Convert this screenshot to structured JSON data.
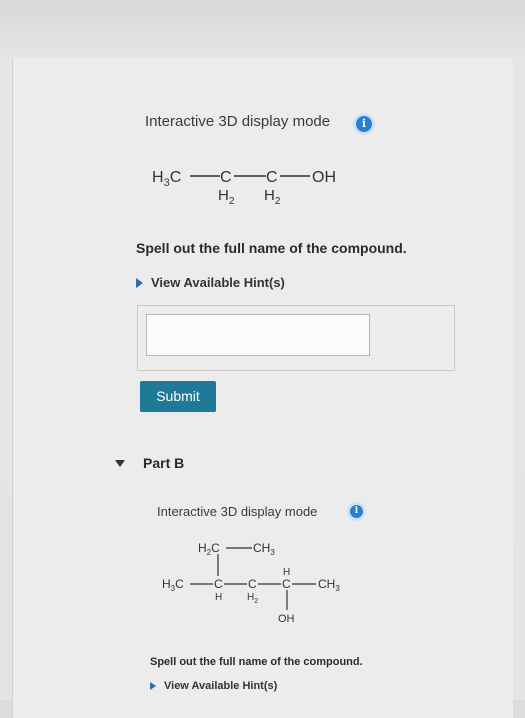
{
  "part_a": {
    "mode_label": "Interactive 3D display mode",
    "info_icon_glyph": "i",
    "molecule": {
      "h3c": "H",
      "h3c_sub": "3",
      "h3c_c": "C",
      "c2": "C",
      "c3": "C",
      "oh": "OH",
      "h2a": "H",
      "h2a_sub": "2",
      "h2b": "H",
      "h2b_sub": "2"
    },
    "question": "Spell out the full name of the compound.",
    "hint_label": "View Available Hint(s)",
    "answer_value": "",
    "submit_label": "Submit"
  },
  "part_b": {
    "title": "Part B",
    "mode_label": "Interactive 3D display mode",
    "info_icon_glyph": "i",
    "molecule": {
      "top_h2c": "H",
      "top_h2c_sub": "2",
      "top_h2c_c": "C",
      "top_ch3": "CH",
      "top_ch3_sub": "3",
      "left_h3c": "H",
      "left_h3c_sub": "3",
      "left_h3c_c": "C",
      "c_a": "C",
      "c_a_h": "H",
      "c_b": "C",
      "c_b_h2": "H",
      "c_b_h2_sub": "2",
      "c_c": "C",
      "c_c_h": "H",
      "right_ch3": "CH",
      "right_ch3_sub": "3",
      "oh": "OH"
    },
    "question": "Spell out the full name of the compound.",
    "hint_label": "View Available Hint(s)"
  },
  "colors": {
    "accent_blue": "#2a7fd4",
    "submit_bg": "#1e7a96",
    "hint_arrow": "#2a6fb0"
  }
}
